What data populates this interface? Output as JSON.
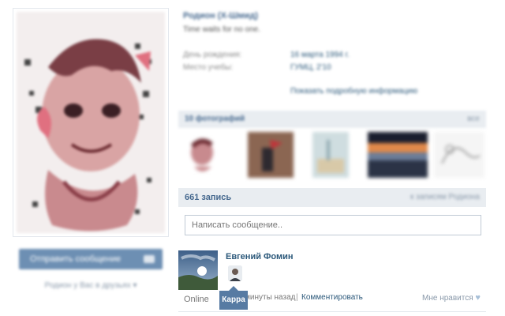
{
  "profile": {
    "name": "Родион (Х-Шмид)",
    "status": "Time waits for no one.",
    "info": [
      {
        "label": "День рождения:",
        "value": "16 марта 1994 г."
      },
      {
        "label": "Место учебы:",
        "value": "ГУМЦ, 2'10"
      }
    ],
    "show_more": "Показать подробную информацию"
  },
  "left_column": {
    "send_message": "Отправить сообщение",
    "friends_link": "Родион у Вас в друзьях ▾"
  },
  "photos": {
    "title": "10 фотографий",
    "all_link": "все"
  },
  "wall": {
    "count_label": "661 запись",
    "toggle_label": "к записям Родиона",
    "input_placeholder": "Написать сообщение.."
  },
  "post": {
    "author": "Евгений Фомин",
    "online": "Online",
    "tooltip": "Карра",
    "time": "минуты назад",
    "separator": "|",
    "comment": "Комментировать",
    "like": "Мне нравится",
    "like_icon": "heart-icon"
  },
  "colors": {
    "accent": "#45688e",
    "link": "#2b587a",
    "button": "#6d8fb3",
    "header_bg": "#e9edf1",
    "tooltip": "#577ba3"
  }
}
